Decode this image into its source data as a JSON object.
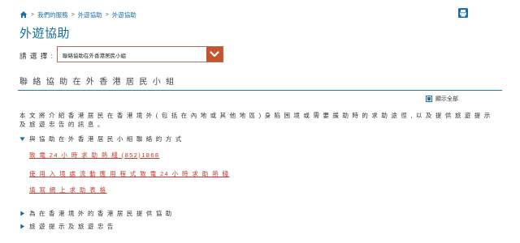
{
  "breadcrumb": {
    "items": [
      "我們的服務",
      "外遊協助",
      "外遊協助"
    ]
  },
  "page": {
    "title": "外遊協助"
  },
  "select": {
    "label": "請 選 擇 :",
    "value": "聯絡協助在外香港居民小組"
  },
  "section": {
    "title": "聯 絡 協 助 在 外 香 港 居 民 小 組",
    "expand_all": "顯示全部",
    "intro": "本 文 將 介 紹 香 港 居 民 在 香 港 境 外 ( 包 括 在 內 地 或 其 他 地 區 ) 身 陷 困 境 或 需 要 援 助 時 的 求 助 途 徑 , 以 及 提 供 旅 遊 提 示 及 旅 遊 忠 告 的 訊 息 。"
  },
  "accordion": [
    {
      "label": "與 協 助 在 外 香 港 居 民 小 組 聯 絡 的 方 式",
      "expanded": true,
      "links": [
        "致 電 24 小 時 求 助 熱 綫 (852)1868",
        "使 用 入 境 處 流 動 應 用 程 式 致 電 24 小 時 求 助 熱 綫",
        "填 寫 網 上 求 助 表 格"
      ]
    },
    {
      "label": "為 在 香 港 境 外 的 香 港 居 民 提 供 協 助",
      "expanded": false
    },
    {
      "label": "旅 遊 提 示 及 旅 遊 忠 告",
      "expanded": false
    }
  ],
  "colors": {
    "accent": "#1a6ea3",
    "link": "#c0392b",
    "select_arrow": "#c4552e"
  },
  "icons": {
    "home": "home-icon",
    "print": "print-icon",
    "expand": "expand-all-icon",
    "dropdown": "chevron-down-icon"
  }
}
